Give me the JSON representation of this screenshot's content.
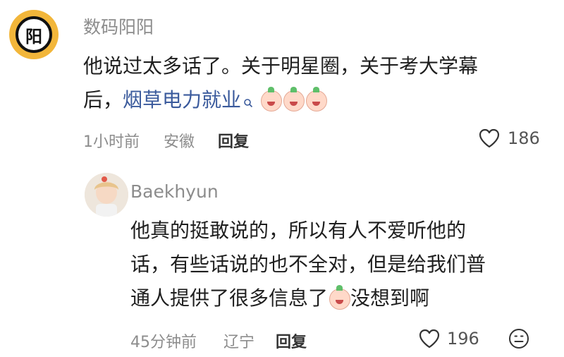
{
  "comment": {
    "avatar_text": "阳",
    "username": "数码阳阳",
    "line1": "他说过太多话了。关于明星圈，关于考大学幕",
    "line2_prefix": "后，",
    "link": "烟草电力就业",
    "time": "1小时前",
    "location": "安徽",
    "reply_label": "回复",
    "likes": "186"
  },
  "reply": {
    "username": "Baekhyun",
    "line1": "他真的挺敢说的，所以有人不爱听他的",
    "line2": "话，有些话说的也不全对，但是给我们普",
    "line3_prefix": "通人提供了很多信息了",
    "line3_suffix": "没想到啊",
    "time": "45分钟前",
    "location": "辽宁",
    "reply_label": "回复",
    "likes": "196"
  }
}
